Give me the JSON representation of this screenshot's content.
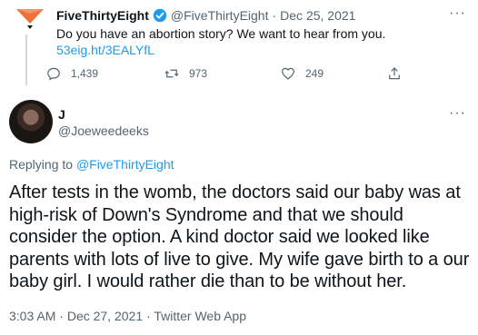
{
  "parent_tweet": {
    "author": "FiveThirtyEight",
    "handle": "@FiveThirtyEight",
    "separator": "·",
    "date": "Dec 25, 2021",
    "text": "Do you have an abortion story? We want to hear from you.",
    "link": "53eig.ht/3EALYfL",
    "replies": "1,439",
    "retweets": "973",
    "likes": "249",
    "more": "···"
  },
  "reply_tweet": {
    "author": "J",
    "handle": "@Joeweedeeks",
    "replying_prefix": "Replying to",
    "replying_to": "@FiveThirtyEight",
    "text": "After tests in the womb, the doctors said our baby was at high-risk of Down's Syndrome and that we should consider the option. A kind doctor said we looked like parents with lots of live to give. My wife gave birth to a our baby girl. I would rather die than to be without her.",
    "time": "3:03 AM",
    "separator1": "·",
    "date": "Dec 27, 2021",
    "separator2": "·",
    "source": "Twitter Web App",
    "more": "···"
  },
  "colors": {
    "accent": "#1d9bf0",
    "muted": "#536471",
    "brand_orange": "#ed713a"
  }
}
